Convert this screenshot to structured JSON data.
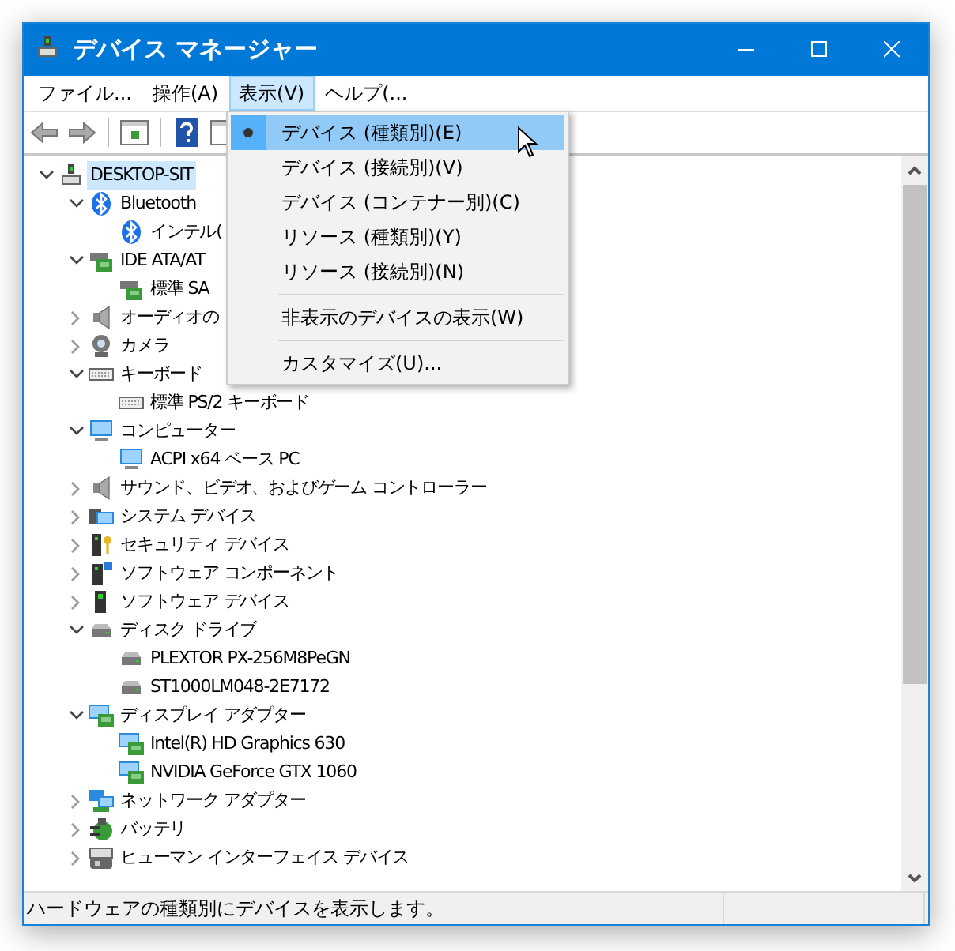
{
  "window": {
    "title": "デバイス マネージャー"
  },
  "menubar": [
    {
      "label": "ファイル...",
      "selected": false
    },
    {
      "label": "操作(A)",
      "selected": false
    },
    {
      "label": "表示(V)",
      "selected": true
    },
    {
      "label": "ヘルプ(...",
      "selected": false
    }
  ],
  "tree": [
    {
      "label": "DESKTOP-SIT",
      "kind": "computer",
      "expanded": true,
      "selected": true,
      "children": [
        {
          "label": "Bluetooth",
          "kind": "bluetooth",
          "expanded": true,
          "selected": false,
          "children": [
            {
              "label": "インテル(",
              "kind": "bluetooth",
              "selected": false
            }
          ]
        },
        {
          "label": "IDE ATA/AT",
          "kind": "controller",
          "expanded": true,
          "selected": false,
          "children": [
            {
              "label": "標準 SA",
              "kind": "controller",
              "selected": false
            }
          ]
        },
        {
          "label": "オーディオの",
          "kind": "audio",
          "expanded": false,
          "selected": false
        },
        {
          "label": "カメラ",
          "kind": "camera",
          "expanded": false,
          "selected": false
        },
        {
          "label": "キーボード",
          "kind": "keyboard",
          "expanded": true,
          "selected": false,
          "children": [
            {
              "label": "標準 PS/2 キーボード",
              "kind": "keyboard",
              "selected": false
            }
          ]
        },
        {
          "label": "コンピューター",
          "kind": "monitor",
          "expanded": true,
          "selected": false,
          "children": [
            {
              "label": "ACPI x64 ベース PC",
              "kind": "monitor",
              "selected": false
            }
          ]
        },
        {
          "label": "サウンド、ビデオ、およびゲーム コントローラー",
          "kind": "audio",
          "expanded": false,
          "selected": false
        },
        {
          "label": "システム デバイス",
          "kind": "system",
          "expanded": false,
          "selected": false
        },
        {
          "label": "セキュリティ デバイス",
          "kind": "security",
          "expanded": false,
          "selected": false
        },
        {
          "label": "ソフトウェア コンポーネント",
          "kind": "component",
          "expanded": false,
          "selected": false
        },
        {
          "label": "ソフトウェア デバイス",
          "kind": "software",
          "expanded": false,
          "selected": false
        },
        {
          "label": "ディスク ドライブ",
          "kind": "disk",
          "expanded": true,
          "selected": false,
          "children": [
            {
              "label": "PLEXTOR PX-256M8PeGN",
              "kind": "disk",
              "selected": false
            },
            {
              "label": "ST1000LM048-2E7172",
              "kind": "disk",
              "selected": false
            }
          ]
        },
        {
          "label": "ディスプレイ アダプター",
          "kind": "display",
          "expanded": true,
          "selected": false,
          "children": [
            {
              "label": "Intel(R) HD Graphics 630",
              "kind": "display",
              "selected": false
            },
            {
              "label": "NVIDIA GeForce GTX 1060",
              "kind": "display",
              "selected": false
            }
          ]
        },
        {
          "label": "ネットワーク アダプター",
          "kind": "network",
          "expanded": false,
          "selected": false
        },
        {
          "label": "バッテリ",
          "kind": "battery",
          "expanded": false,
          "selected": false
        },
        {
          "label": "ヒューマン インターフェイス デバイス",
          "kind": "hid",
          "expanded": false,
          "selected": false
        }
      ]
    }
  ],
  "view_menu": [
    {
      "kind": "item",
      "label": "デバイス (種類別)(E)",
      "checked": true,
      "highlighted": true
    },
    {
      "kind": "item",
      "label": "デバイス (接続別)(V)",
      "checked": false,
      "highlighted": false
    },
    {
      "kind": "item",
      "label": "デバイス (コンテナー別)(C)",
      "checked": false,
      "highlighted": false
    },
    {
      "kind": "item",
      "label": "リソース (種類別)(Y)",
      "checked": false,
      "highlighted": false
    },
    {
      "kind": "item",
      "label": "リソース (接続別)(N)",
      "checked": false,
      "highlighted": false
    },
    {
      "kind": "separator"
    },
    {
      "kind": "item",
      "label": "非表示のデバイスの表示(W)",
      "checked": false,
      "highlighted": false
    },
    {
      "kind": "separator"
    },
    {
      "kind": "item",
      "label": "カスタマイズ(U)...",
      "checked": false,
      "highlighted": false
    }
  ],
  "status_bar": {
    "text": "ハードウェアの種類別にデバイスを表示します。"
  }
}
